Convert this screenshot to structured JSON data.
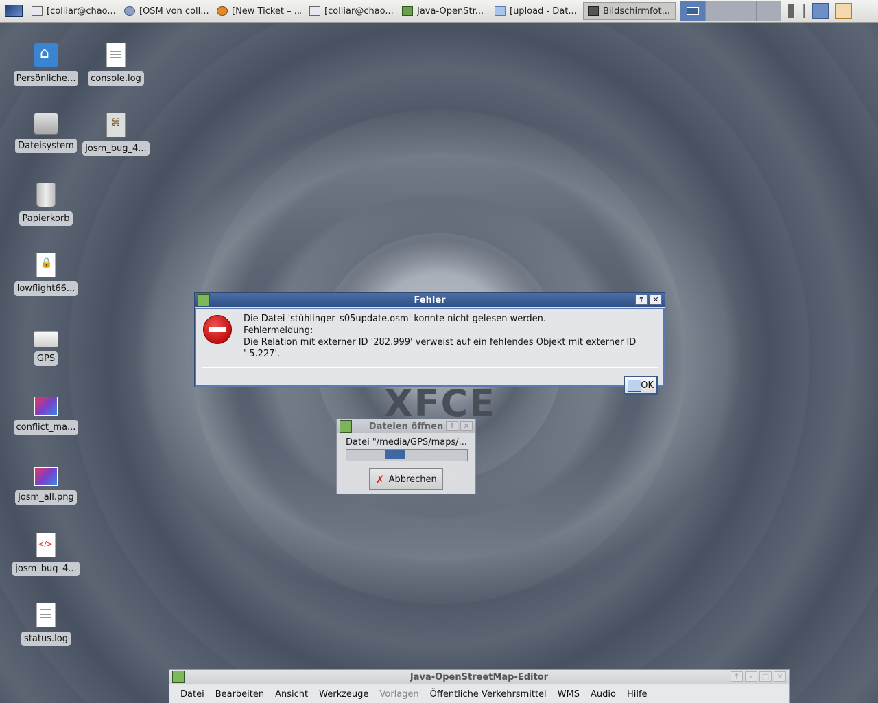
{
  "taskbar": {
    "tasks": [
      {
        "label": "[colliar@chao...",
        "icon": "terminal-icon"
      },
      {
        "label": "[OSM von coll...",
        "icon": "gear-icon"
      },
      {
        "label": "[New Ticket – ...",
        "icon": "firefox-icon"
      },
      {
        "label": "[colliar@chao...",
        "icon": "terminal-icon"
      },
      {
        "label": "Java-OpenStr...",
        "icon": "josm-icon"
      },
      {
        "label": "[upload - Dat...",
        "icon": "folder-icon"
      },
      {
        "label": "Bildschirmfot...",
        "icon": "camera-icon"
      }
    ],
    "active_task": 6,
    "workspaces": 4,
    "active_workspace": 0
  },
  "desktop": {
    "icons": [
      {
        "label": "Persönliche...",
        "icon": "home-folder-icon"
      },
      {
        "label": "console.log",
        "icon": "text-file-icon"
      },
      {
        "label": "Dateisystem",
        "icon": "hard-disk-icon"
      },
      {
        "label": "josm_bug_4...",
        "icon": "package-icon"
      },
      {
        "label": "Papierkorb",
        "icon": "trash-icon"
      },
      {
        "label": "lowflight66...",
        "icon": "locked-file-icon"
      },
      {
        "label": "GPS",
        "icon": "removable-drive-icon"
      },
      {
        "label": "conflict_ma...",
        "icon": "image-file-icon"
      },
      {
        "label": "josm_all.png",
        "icon": "image-file-icon"
      },
      {
        "label": "josm_bug_4...",
        "icon": "xml-file-icon"
      },
      {
        "label": "status.log",
        "icon": "text-file-icon"
      }
    ]
  },
  "wallpaper": {
    "text": "XFCE"
  },
  "error_dialog": {
    "title": "Fehler",
    "line1": "Die Datei 'stühlinger_s05update.osm' konnte nicht gelesen werden.",
    "line2": "Fehlermeldung:",
    "line3": "Die Relation mit externer ID '282.999' verweist auf ein fehlendes Objekt mit externer ID '-5.227'.",
    "ok_label": "OK",
    "maximize_label": "↑",
    "close_label": "✕"
  },
  "open_dialog": {
    "title": "Dateien öffnen",
    "file_text": "Datei \"/media/GPS/maps/...",
    "cancel_label": "Abbrechen",
    "maximize_label": "↑",
    "close_label": "✕"
  },
  "josm_window": {
    "title": "Java-OpenStreetMap-Editor",
    "menu": [
      {
        "label": "Datei",
        "enabled": true
      },
      {
        "label": "Bearbeiten",
        "enabled": true
      },
      {
        "label": "Ansicht",
        "enabled": true
      },
      {
        "label": "Werkzeuge",
        "enabled": true
      },
      {
        "label": "Vorlagen",
        "enabled": false
      },
      {
        "label": "Öffentliche Verkehrsmittel",
        "enabled": true
      },
      {
        "label": "WMS",
        "enabled": true
      },
      {
        "label": "Audio",
        "enabled": true
      },
      {
        "label": "Hilfe",
        "enabled": true
      }
    ],
    "btn_max": "↑",
    "btn_min": "–",
    "btn_restore": "□",
    "btn_close": "✕"
  }
}
